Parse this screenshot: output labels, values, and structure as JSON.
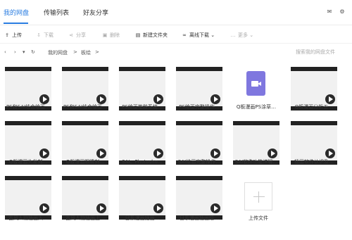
{
  "nav": {
    "tabs": [
      "我的网盘",
      "传输列表",
      "好友分享"
    ],
    "active_tab": 0,
    "accent_color": "#2a7de1",
    "right_icons": [
      "mail-icon",
      "settings-icon"
    ]
  },
  "toolbar": {
    "upload": "上传",
    "download": "下载",
    "share": "分享",
    "delete": "删除",
    "new_folder": "新建文件夹",
    "offline_download": "离线下载",
    "more": "更多"
  },
  "path": {
    "crumb_root": "我的网盘",
    "crumb_current": "板绘",
    "sep1": ">",
    "sep2": ">",
    "search_placeholder": "搜索我的网盘文件"
  },
  "files": [
    {
      "name": "PS和SAI结合绘画…",
      "type": "video"
    },
    {
      "name": "PS和SAI结合绘画…",
      "type": "video"
    },
    {
      "name": "PS绘画笔触系统…",
      "type": "video"
    },
    {
      "name": "PS绘画完整操作…",
      "type": "video"
    },
    {
      "name": "Q板漫画PS涂草…",
      "type": "video-file"
    },
    {
      "name": "Q板漫画分析五…",
      "type": "video"
    },
    {
      "name": "Q版漫画头发刻…",
      "type": "video"
    },
    {
      "name": "Q版漫画眼睛刻…",
      "type": "video"
    },
    {
      "name": "SAI、Photosho…",
      "type": "video"
    },
    {
      "name": "SAI绘画完整操作…",
      "type": "video"
    },
    {
      "name": "SAI软件功能详解…",
      "type": "video"
    },
    {
      "name": "插画软件认识及…",
      "type": "video"
    },
    {
      "name": "古风人物插画入…",
      "type": "video"
    },
    {
      "name": "古风人物插画上…",
      "type": "video"
    },
    {
      "name": "日系漫画插画…",
      "type": "video"
    },
    {
      "name": "日系漫画插画绘…",
      "type": "video"
    }
  ],
  "upload_label": "上传文件"
}
